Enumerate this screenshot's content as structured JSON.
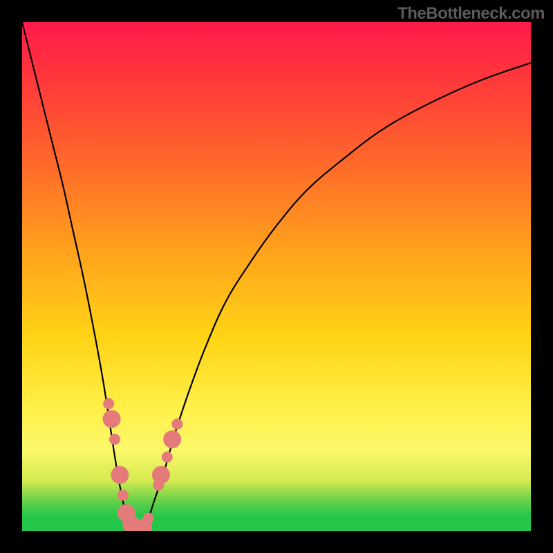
{
  "attribution": "TheBottleneck.com",
  "chart_data": {
    "type": "line",
    "title": "",
    "xlabel": "",
    "ylabel": "",
    "xlim": [
      0,
      100
    ],
    "ylim": [
      0,
      100
    ],
    "series": [
      {
        "name": "left-branch",
        "x": [
          0,
          2,
          4,
          6,
          8,
          10,
          12,
          14,
          16,
          18,
          19,
          20,
          21,
          22,
          23
        ],
        "values": [
          100,
          92,
          84,
          76,
          68,
          59,
          50,
          40,
          29,
          16,
          10,
          5,
          2,
          0.8,
          0
        ]
      },
      {
        "name": "right-branch",
        "x": [
          23,
          24,
          25,
          26,
          28,
          30,
          33,
          36,
          40,
          45,
          50,
          56,
          63,
          71,
          80,
          90,
          100
        ],
        "values": [
          0,
          1,
          3,
          6,
          12,
          19,
          28,
          36,
          45,
          53,
          60,
          67,
          73,
          79,
          84,
          88.5,
          92
        ]
      }
    ],
    "markers": {
      "name": "highlight-dots",
      "color": "#e47a7a",
      "points": [
        {
          "x": 17.0,
          "y": 25,
          "r": 8
        },
        {
          "x": 17.6,
          "y": 22,
          "r": 13
        },
        {
          "x": 18.2,
          "y": 18,
          "r": 8
        },
        {
          "x": 19.2,
          "y": 11,
          "r": 13
        },
        {
          "x": 19.8,
          "y": 7,
          "r": 8
        },
        {
          "x": 20.5,
          "y": 3.5,
          "r": 13
        },
        {
          "x": 21.5,
          "y": 1.2,
          "r": 13
        },
        {
          "x": 22.5,
          "y": 0.4,
          "r": 8
        },
        {
          "x": 23.8,
          "y": 0.6,
          "r": 13
        },
        {
          "x": 24.8,
          "y": 2.5,
          "r": 8
        },
        {
          "x": 26.8,
          "y": 9,
          "r": 8
        },
        {
          "x": 27.3,
          "y": 11,
          "r": 13
        },
        {
          "x": 28.5,
          "y": 14.5,
          "r": 8
        },
        {
          "x": 29.5,
          "y": 18,
          "r": 13
        },
        {
          "x": 30.5,
          "y": 21,
          "r": 8
        }
      ]
    }
  }
}
